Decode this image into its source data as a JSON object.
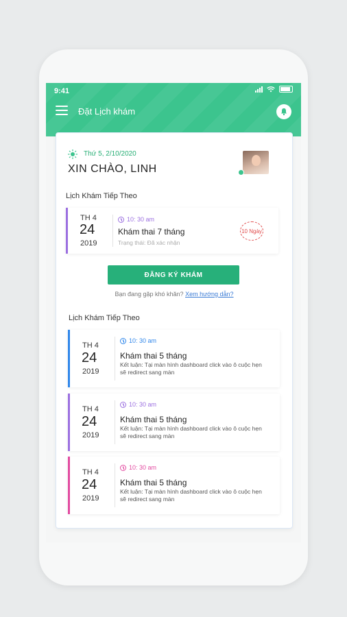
{
  "status": {
    "time": "9:41"
  },
  "header": {
    "title": "Đặt Lịch khám"
  },
  "user": {
    "date": "Thứ 5, 2/10/2020",
    "greeting": "XIN CHÀO, LINH"
  },
  "next_section_title": "Lịch Khám Tiếp Theo",
  "next_appointment": {
    "dow": "TH 4",
    "day": "24",
    "year": "2019",
    "time": "10: 30 am",
    "title": "Khám thai 7 tháng",
    "status": "Trạng thái: Đã xác nhận",
    "countdown": "10 Ngày",
    "accent": "#9b6fe0"
  },
  "register_button": "ĐĂNG KÝ KHÁM",
  "help": {
    "text": "Bạn đang gặp khó khăn?",
    "link": "Xem hướng dẫn?"
  },
  "list_section_title": "Lịch Khám Tiếp Theo",
  "appointments": [
    {
      "dow": "TH 4",
      "day": "24",
      "year": "2019",
      "time": "10: 30 am",
      "title": "Khám thai 5 tháng",
      "desc": "Kết luận: Tại màn hình dashboard click vào ô cuộc hẹn sẽ redirect sang màn",
      "accent": "#2f86ea"
    },
    {
      "dow": "TH 4",
      "day": "24",
      "year": "2019",
      "time": "10: 30 am",
      "title": "Khám thai 5 tháng",
      "desc": "Kết luận: Tại màn hình dashboard click vào ô cuộc hẹn sẽ redirect sang màn",
      "accent": "#9b6fe0"
    },
    {
      "dow": "TH 4",
      "day": "24",
      "year": "2019",
      "time": "10: 30 am",
      "title": "Khám thai 5 tháng",
      "desc": "Kết luận: Tại màn hình dashboard click vào ô cuộc hẹn sẽ redirect sang màn",
      "accent": "#e24aa0"
    }
  ],
  "colors": {
    "primary": "#3cc48e",
    "button": "#27b07a",
    "countdown": "#e04a4a"
  },
  "icons": {
    "menu": "hamburger-icon",
    "notification": "bell-icon",
    "weather": "sun-icon",
    "time": "clock-icon"
  }
}
